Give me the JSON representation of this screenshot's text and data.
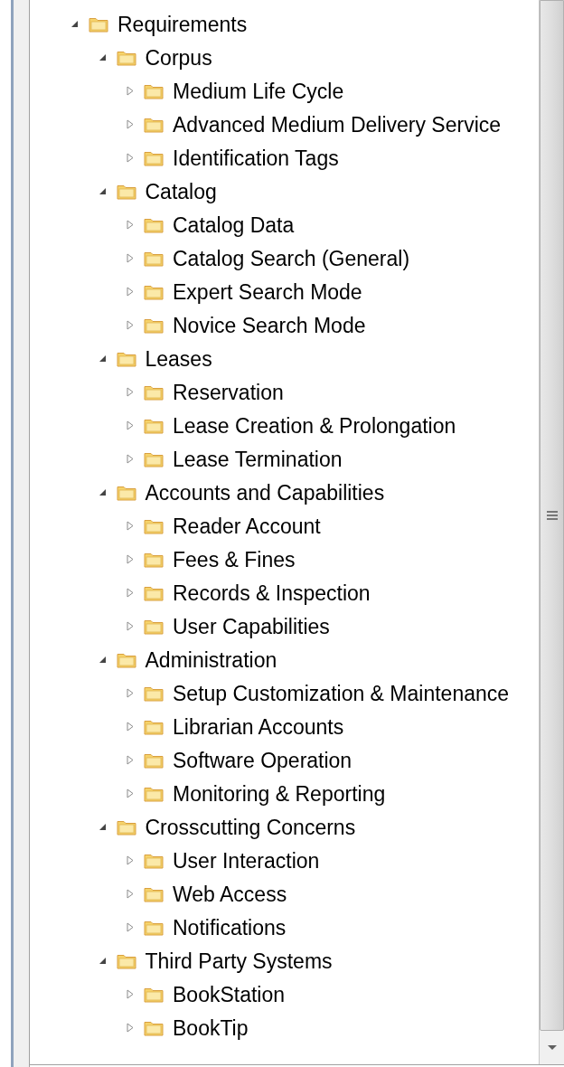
{
  "tree": [
    {
      "label": "Requirements",
      "expanded": true,
      "children": [
        {
          "label": "Corpus",
          "expanded": true,
          "children": [
            {
              "label": "Medium Life Cycle",
              "expanded": false
            },
            {
              "label": "Advanced Medium Delivery Service",
              "expanded": false
            },
            {
              "label": "Identification Tags",
              "expanded": false
            }
          ]
        },
        {
          "label": "Catalog",
          "expanded": true,
          "children": [
            {
              "label": "Catalog Data",
              "expanded": false
            },
            {
              "label": "Catalog Search (General)",
              "expanded": false
            },
            {
              "label": "Expert Search Mode",
              "expanded": false
            },
            {
              "label": "Novice Search Mode",
              "expanded": false
            }
          ]
        },
        {
          "label": "Leases",
          "expanded": true,
          "children": [
            {
              "label": "Reservation",
              "expanded": false
            },
            {
              "label": "Lease Creation & Prolongation",
              "expanded": false
            },
            {
              "label": "Lease Termination",
              "expanded": false
            }
          ]
        },
        {
          "label": "Accounts and Capabilities",
          "expanded": true,
          "children": [
            {
              "label": "Reader Account",
              "expanded": false
            },
            {
              "label": "Fees & Fines",
              "expanded": false
            },
            {
              "label": "Records & Inspection",
              "expanded": false
            },
            {
              "label": "User Capabilities",
              "expanded": false
            }
          ]
        },
        {
          "label": "Administration",
          "expanded": true,
          "children": [
            {
              "label": "Setup Customization & Maintenance",
              "expanded": false
            },
            {
              "label": "Librarian Accounts",
              "expanded": false
            },
            {
              "label": "Software Operation",
              "expanded": false
            },
            {
              "label": "Monitoring & Reporting",
              "expanded": false
            }
          ]
        },
        {
          "label": "Crosscutting Concerns",
          "expanded": true,
          "children": [
            {
              "label": "User Interaction",
              "expanded": false
            },
            {
              "label": "Web Access",
              "expanded": false
            },
            {
              "label": "Notifications",
              "expanded": false
            }
          ]
        },
        {
          "label": "Third Party Systems",
          "expanded": true,
          "children": [
            {
              "label": "BookStation",
              "expanded": false
            },
            {
              "label": "BookTip",
              "expanded": false
            }
          ]
        }
      ]
    }
  ]
}
